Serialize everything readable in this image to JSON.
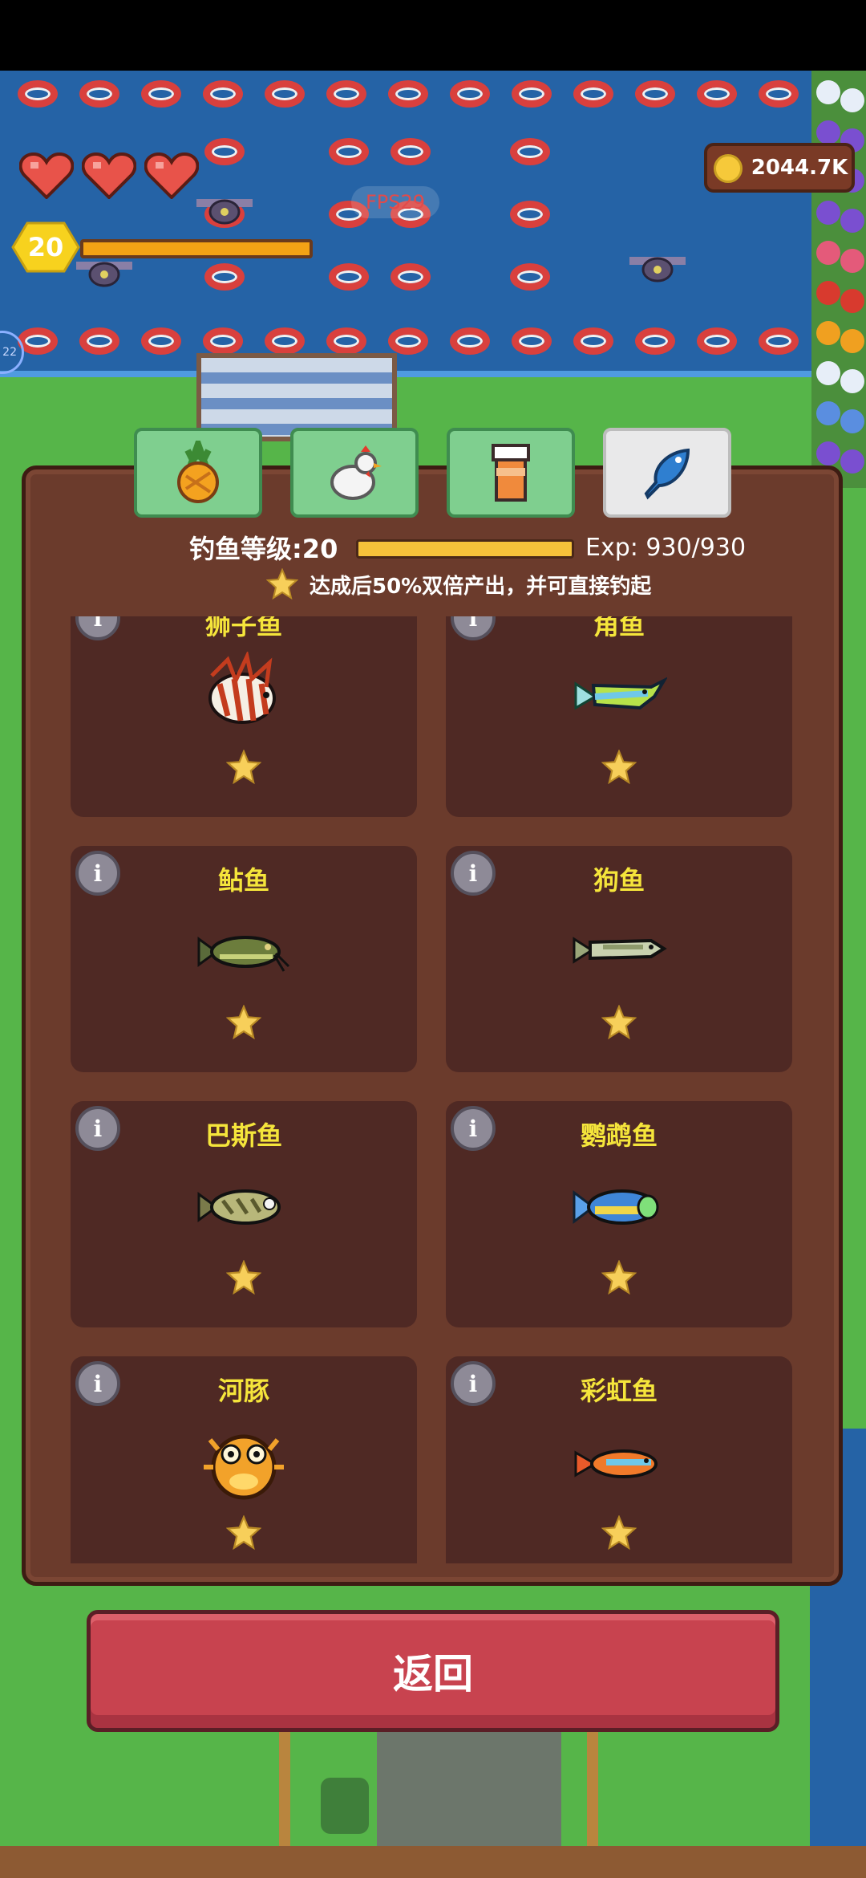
{
  "hud": {
    "hearts": 3,
    "player_level": "20",
    "fps": "FPS29",
    "coins": "2044.7K",
    "side_chip": "22"
  },
  "tabs": [
    {
      "name": "crops",
      "icon": "pineapple-icon",
      "active": false
    },
    {
      "name": "animals",
      "icon": "chicken-icon",
      "active": false
    },
    {
      "name": "crafting",
      "icon": "jar-icon",
      "active": false
    },
    {
      "name": "fishing",
      "icon": "fish-icon",
      "active": true
    }
  ],
  "panel": {
    "level_label": "钓鱼等级:20",
    "exp_text": "Exp: 930/930",
    "exp_fill": 1.0,
    "bonus_text": "达成后50%双倍产出，并可直接钓起"
  },
  "fish": [
    {
      "name": "狮子鱼",
      "icon": "lionfish-icon",
      "stars": 1
    },
    {
      "name": "角鱼",
      "icon": "hornfish-icon",
      "stars": 1
    },
    {
      "name": "鲇鱼",
      "icon": "catfish-icon",
      "stars": 1
    },
    {
      "name": "狗鱼",
      "icon": "pike-icon",
      "stars": 1
    },
    {
      "name": "巴斯鱼",
      "icon": "bass-icon",
      "stars": 1
    },
    {
      "name": "鹦鹉鱼",
      "icon": "parrotfish-icon",
      "stars": 1
    },
    {
      "name": "河豚",
      "icon": "pufferfish-icon",
      "stars": 1
    },
    {
      "name": "彩虹鱼",
      "icon": "rainbowfish-icon",
      "stars": 1
    }
  ],
  "info_label": "i",
  "back_button": "返回",
  "colors": {
    "accent_yellow": "#f5e53b",
    "panel_brown": "#6b3b2c",
    "card_brown": "#4f2924",
    "button_red": "#c8434f",
    "tab_green": "#7fcf8f"
  }
}
